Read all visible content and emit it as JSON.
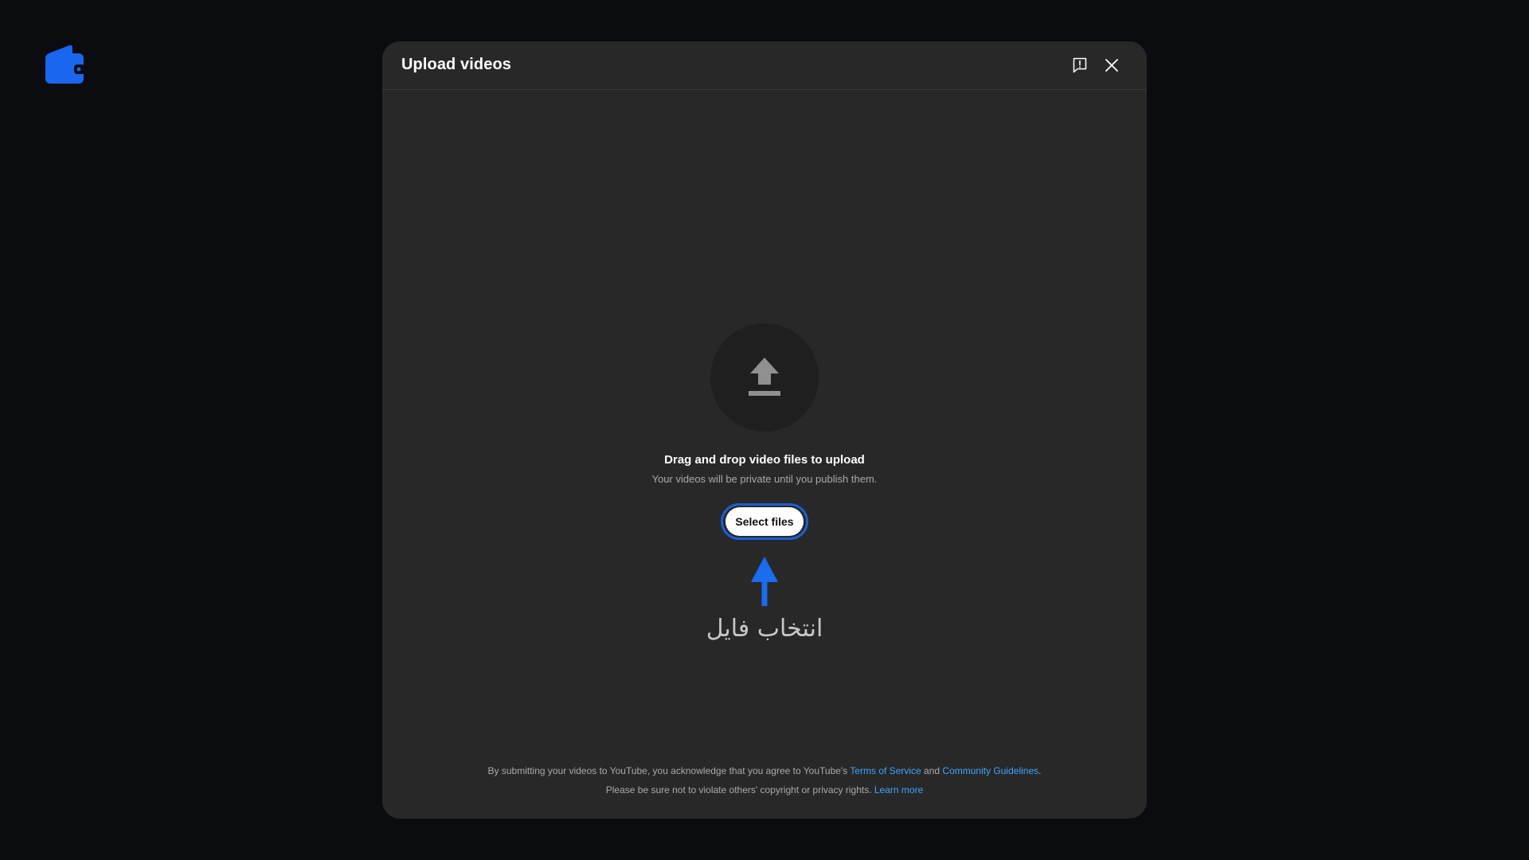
{
  "app_logo": {
    "icon": "wallet-icon",
    "color": "#1a66ee"
  },
  "dialog": {
    "title": "Upload videos",
    "feedback_icon": "feedback-icon",
    "close_icon": "close-icon"
  },
  "upload": {
    "icon": "upload-arrow-icon",
    "title": "Drag and drop video files to upload",
    "subtitle": "Your videos will be private until you publish them.",
    "select_button": "Select files"
  },
  "annotation": {
    "arrow_icon": "arrow-up-icon",
    "arrow_color": "#1a6cf0",
    "label": "انتخاب فایل"
  },
  "footer": {
    "line1_prefix": "By submitting your videos to YouTube, you acknowledge that you agree to YouTube's ",
    "terms_link": "Terms of Service",
    "and": " and ",
    "guidelines_link": "Community Guidelines",
    "period": ".",
    "line2_prefix": "Please be sure not to violate others' copyright or privacy rights. ",
    "learn_more_link": "Learn more"
  },
  "colors": {
    "background": "#0b0c10",
    "dialog_bg": "#282828",
    "link": "#3ea6ff",
    "accent_ring": "#1a5fd6"
  }
}
